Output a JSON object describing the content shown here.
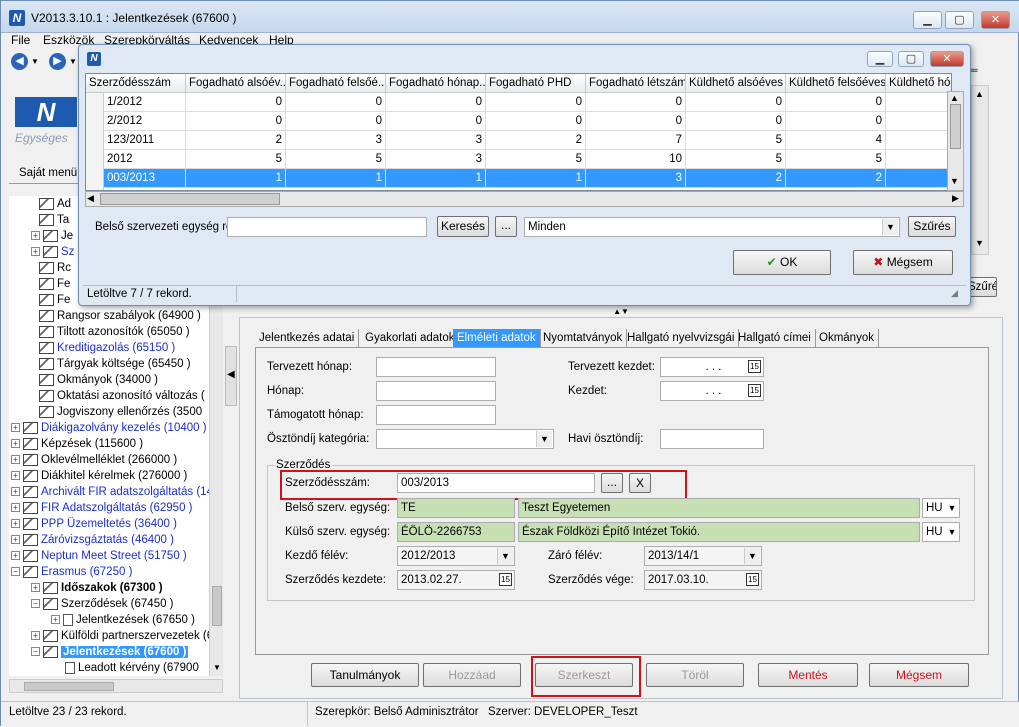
{
  "app": {
    "title": "V2013.3.10.1 : Jelentkezések (67600  )",
    "logo_text": "Egységes",
    "accent": "#3399ff"
  },
  "menu": [
    "File",
    "Eszközök",
    "Szerepkörváltás",
    "Kedvencek",
    "Help"
  ],
  "left": {
    "own_menu": "Saját menü"
  },
  "tree": [
    {
      "label": "Ad",
      "indent": 30,
      "exp": "",
      "icon": "book",
      "style": ""
    },
    {
      "label": "Ta",
      "indent": 30,
      "exp": "",
      "icon": "book",
      "style": ""
    },
    {
      "label": "Je",
      "indent": 22,
      "exp": "+",
      "icon": "book",
      "style": ""
    },
    {
      "label": "Sz",
      "indent": 22,
      "exp": "+",
      "icon": "book",
      "style": "blue"
    },
    {
      "label": "Rc",
      "indent": 30,
      "exp": "",
      "icon": "book",
      "style": ""
    },
    {
      "label": "Fe",
      "indent": 30,
      "exp": "",
      "icon": "book",
      "style": ""
    },
    {
      "label": "Fe",
      "indent": 30,
      "exp": "",
      "icon": "book",
      "style": ""
    },
    {
      "label": "Rangsor szabályok  (64900  )",
      "indent": 30,
      "exp": "",
      "icon": "book",
      "style": ""
    },
    {
      "label": "Tiltott azonosítók  (65050  )",
      "indent": 30,
      "exp": "",
      "icon": "book",
      "style": ""
    },
    {
      "label": "Kreditigazolás  (65150  )",
      "indent": 30,
      "exp": "",
      "icon": "book",
      "style": "blue"
    },
    {
      "label": "Tárgyak költsége  (65450  )",
      "indent": 30,
      "exp": "",
      "icon": "book",
      "style": ""
    },
    {
      "label": "Okmányok  (34000  )",
      "indent": 30,
      "exp": "",
      "icon": "book",
      "style": ""
    },
    {
      "label": "Oktatási azonosító változás  (",
      "indent": 30,
      "exp": "",
      "icon": "book",
      "style": ""
    },
    {
      "label": "Jogviszony ellenőrzés  (3500",
      "indent": 30,
      "exp": "",
      "icon": "book",
      "style": ""
    },
    {
      "label": "Diákigazolvány kezelés  (10400  )",
      "indent": 2,
      "exp": "+",
      "icon": "book",
      "style": "blue"
    },
    {
      "label": "Képzések  (115600  )",
      "indent": 2,
      "exp": "+",
      "icon": "book",
      "style": ""
    },
    {
      "label": "Oklevélmelléklet  (266000  )",
      "indent": 2,
      "exp": "+",
      "icon": "book",
      "style": ""
    },
    {
      "label": "Diákhitel kérelmek  (276000  )",
      "indent": 2,
      "exp": "+",
      "icon": "book",
      "style": ""
    },
    {
      "label": "Archivált FIR adatszolgáltatás  (14",
      "indent": 2,
      "exp": "+",
      "icon": "book",
      "style": "blue"
    },
    {
      "label": "FIR Adatszolgáltatás  (62950  )",
      "indent": 2,
      "exp": "+",
      "icon": "book",
      "style": "blue"
    },
    {
      "label": "PPP Üzemeltetés  (36400  )",
      "indent": 2,
      "exp": "+",
      "icon": "book",
      "style": "blue"
    },
    {
      "label": "Záróvizsgáztatás  (46400  )",
      "indent": 2,
      "exp": "+",
      "icon": "book",
      "style": "blue"
    },
    {
      "label": "Neptun Meet Street  (51750  )",
      "indent": 2,
      "exp": "+",
      "icon": "book",
      "style": "blue"
    },
    {
      "label": "Erasmus  (67250  )",
      "indent": 2,
      "exp": "−",
      "icon": "book",
      "style": "blue"
    },
    {
      "label": "Időszakok  (67300  )",
      "indent": 22,
      "exp": "+",
      "icon": "book",
      "style": "bold"
    },
    {
      "label": "Szerződések  (67450  )",
      "indent": 22,
      "exp": "−",
      "icon": "book",
      "style": ""
    },
    {
      "label": "Jelentkezések  (67650  )",
      "indent": 42,
      "exp": "+",
      "icon": "doc",
      "style": ""
    },
    {
      "label": "Külföldi partnerszervezetek  (6",
      "indent": 22,
      "exp": "+",
      "icon": "book",
      "style": ""
    },
    {
      "label": "Jelentkezések  (67600  )",
      "indent": 22,
      "exp": "−",
      "icon": "book",
      "style": "sel"
    },
    {
      "label": "Leadott kérvény  (67900",
      "indent": 56,
      "exp": "",
      "icon": "doc",
      "style": ""
    }
  ],
  "dialog": {
    "columns": [
      "Szerződésszám",
      "Fogadható alsóév...",
      "Fogadható felsőé...",
      "Fogadható hónap...",
      "Fogadható PHD",
      "Fogadható létszám",
      "Küldhető alsóéves",
      "Küldhető felsőéves",
      "Küldhető hó"
    ],
    "rows": [
      {
        "c": [
          "1/2012",
          "0",
          "0",
          "0",
          "0",
          "0",
          "0",
          "0",
          ""
        ],
        "sel": false
      },
      {
        "c": [
          "2/2012",
          "0",
          "0",
          "0",
          "0",
          "0",
          "0",
          "0",
          ""
        ],
        "sel": false
      },
      {
        "c": [
          "123/2011",
          "2",
          "3",
          "3",
          "2",
          "7",
          "5",
          "4",
          ""
        ],
        "sel": false
      },
      {
        "c": [
          "2012",
          "5",
          "5",
          "3",
          "5",
          "10",
          "5",
          "5",
          ""
        ],
        "sel": false
      },
      {
        "c": [
          "003/2013",
          "1",
          "1",
          "1",
          "1",
          "3",
          "2",
          "2",
          ""
        ],
        "sel": true
      }
    ],
    "filter_label": "Belső szervezeti egység röv",
    "search_btn": "Keresés",
    "dots_btn": "...",
    "combo_value": "Minden",
    "filter_btn": "Szűrés",
    "ok_btn": "OK",
    "cancel_btn": "Mégsem",
    "status": "Letöltve 7 / 7 rekord."
  },
  "right_filter_btn": "Szűrés",
  "tabs": [
    "Jelentkezés adatai",
    "Gyakorlati adatok",
    "Elméleti adatok",
    "Nyomtatványok",
    "Hallgató nyelvvizsgái",
    "Hallgató címei",
    "Okmányok"
  ],
  "active_tab": 2,
  "form": {
    "planned_month": "Tervezett hónap:",
    "month": "Hónap:",
    "supported_month": "Támogatott hónap:",
    "scholarship_cat": "Ösztöndíj kategória:",
    "planned_start": "Tervezett kezdet:",
    "start": "Kezdet:",
    "monthly_scholarship": "Havi ösztöndíj:",
    "date_placeholder": ". . .",
    "contract_group": "Szerződés",
    "contract_no_label": "Szerződésszám:",
    "contract_no": "003/2013",
    "dots": "...",
    "clear": "X",
    "internal_unit_label": "Belső szerv. egység:",
    "internal_code": "TE",
    "internal_name": "Teszt Egyetemen",
    "external_unit_label": "Külső szerv. egység:",
    "external_code": "ÉÖLÖ-2266753",
    "external_name": "Észak Földközi Építő Intézet Tokió.",
    "lang": "HU",
    "start_sem_label": "Kezdő félév:",
    "start_sem": "2012/2013",
    "end_sem_label": "Záró félév:",
    "end_sem": "2013/14/1",
    "contract_start_label": "Szerződés kezdete:",
    "contract_start": "2013.02.27.",
    "contract_end_label": "Szerződés vége:",
    "contract_end": "2017.03.10."
  },
  "actions": {
    "studies": "Tanulmányok",
    "add": "Hozzáad",
    "edit": "Szerkeszt",
    "delete": "Töröl",
    "save": "Mentés",
    "cancel": "Mégsem"
  },
  "status": {
    "left": "Letöltve 23 / 23 rekord.",
    "role": "Szerepkör: Belső Adminisztrátor",
    "server": "Szerver: DEVELOPER_Teszt"
  }
}
